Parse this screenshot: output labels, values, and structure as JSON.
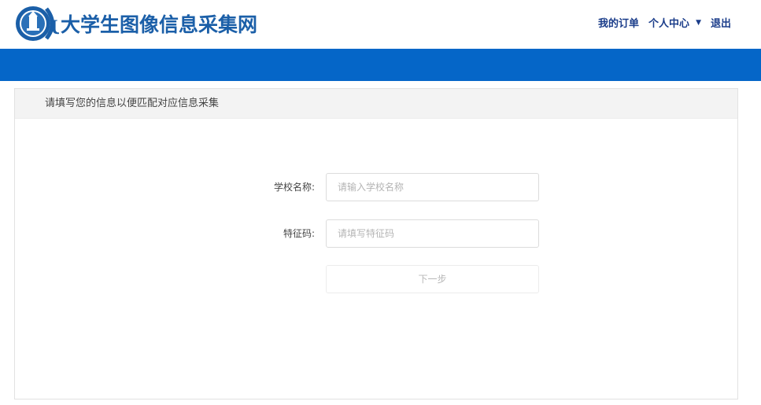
{
  "header": {
    "site_title": "大学生图像信息采集网",
    "logo_letter": "U",
    "nav": {
      "orders": "我的订单",
      "user_center": "个人中心",
      "logout": "退出"
    }
  },
  "panel": {
    "title": "请填写您的信息以便匹配对应信息采集"
  },
  "form": {
    "school": {
      "label": "学校名称:",
      "placeholder": "请输入学校名称",
      "value": ""
    },
    "code": {
      "label": "特征码:",
      "placeholder": "请填写特征码",
      "value": ""
    },
    "next_label": "下一步"
  },
  "colors": {
    "brand_blue": "#0566c8",
    "title_blue": "#1b5fa8",
    "nav_text": "#1b3d8a"
  },
  "icons": {
    "logo": "university-seal-logo-icon",
    "dropdown": "caret-down-icon"
  }
}
